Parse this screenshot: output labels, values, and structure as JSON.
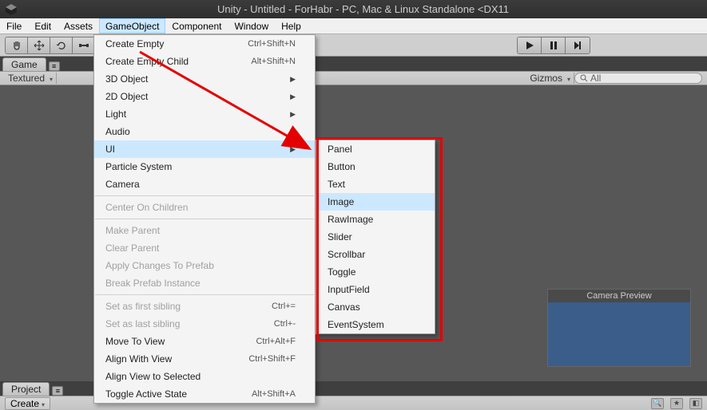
{
  "title": "Unity - Untitled - ForHabr - PC, Mac & Linux Standalone <DX11",
  "menubar": [
    "File",
    "Edit",
    "Assets",
    "GameObject",
    "Component",
    "Window",
    "Help"
  ],
  "menubar_active_index": 3,
  "toolbar_icons": [
    "hand",
    "move",
    "rotate",
    "scale"
  ],
  "play_icons": [
    "play",
    "pause",
    "step"
  ],
  "game_tab": "Game",
  "subbar": {
    "textured": "Textured",
    "gizmos": "Gizmos",
    "search_prefix": "All"
  },
  "gameobject_menu": [
    {
      "label": "Create Empty",
      "shortcut": "Ctrl+Shift+N"
    },
    {
      "label": "Create Empty Child",
      "shortcut": "Alt+Shift+N"
    },
    {
      "label": "3D Object",
      "submenu": true
    },
    {
      "label": "2D Object",
      "submenu": true
    },
    {
      "label": "Light",
      "submenu": true
    },
    {
      "label": "Audio",
      "submenu": true
    },
    {
      "label": "UI",
      "submenu": true,
      "highlight": true
    },
    {
      "label": "Particle System"
    },
    {
      "label": "Camera"
    },
    {
      "sep": true
    },
    {
      "label": "Center On Children",
      "disabled": true
    },
    {
      "sep": true
    },
    {
      "label": "Make Parent",
      "disabled": true
    },
    {
      "label": "Clear Parent",
      "disabled": true
    },
    {
      "label": "Apply Changes To Prefab",
      "disabled": true
    },
    {
      "label": "Break Prefab Instance",
      "disabled": true
    },
    {
      "sep": true
    },
    {
      "label": "Set as first sibling",
      "shortcut": "Ctrl+=",
      "disabled": true
    },
    {
      "label": "Set as last sibling",
      "shortcut": "Ctrl+-",
      "disabled": true
    },
    {
      "label": "Move To View",
      "shortcut": "Ctrl+Alt+F"
    },
    {
      "label": "Align With View",
      "shortcut": "Ctrl+Shift+F"
    },
    {
      "label": "Align View to Selected"
    },
    {
      "label": "Toggle Active State",
      "shortcut": "Alt+Shift+A"
    }
  ],
  "ui_submenu": [
    "Panel",
    "Button",
    "Text",
    "Image",
    "RawImage",
    "Slider",
    "Scrollbar",
    "Toggle",
    "InputField",
    "Canvas",
    "EventSystem"
  ],
  "ui_submenu_highlight": "Image",
  "project_tab": "Project",
  "create_label": "Create",
  "camera_preview_title": "Camera Preview"
}
